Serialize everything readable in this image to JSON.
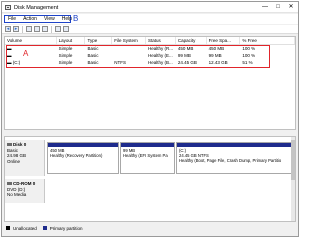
{
  "window": {
    "title": "Disk Management",
    "min": "—",
    "max": "□",
    "close": "✕"
  },
  "menu": {
    "items": [
      "File",
      "Action",
      "View",
      "Help"
    ]
  },
  "annotations": {
    "a": "A",
    "b": "B"
  },
  "volumes": {
    "headers": [
      "Volume",
      "Layout",
      "Type",
      "File System",
      "Status",
      "Capacity",
      "Free Spa...",
      "% Free"
    ],
    "rows": [
      {
        "volume": "",
        "layout": "Simple",
        "type": "Basic",
        "fs": "",
        "status": "Healthy (R...",
        "capacity": "450 MB",
        "free": "450 MB",
        "pct": "100 %"
      },
      {
        "volume": "",
        "layout": "Simple",
        "type": "Basic",
        "fs": "",
        "status": "Healthy (E...",
        "capacity": "99 MB",
        "free": "99 MB",
        "pct": "100 %"
      },
      {
        "volume": "(C:)",
        "layout": "Simple",
        "type": "Basic",
        "fs": "NTFS",
        "status": "Healthy (B...",
        "capacity": "24.45 GB",
        "free": "12.43 GB",
        "pct": "51 %"
      }
    ]
  },
  "disks": [
    {
      "name": "Disk 0",
      "kind": "Basic",
      "size": "24.98 GB",
      "state": "Online",
      "partitions": [
        {
          "title": "",
          "size": "450 MB",
          "status": "Healthy (Recovery Partition)"
        },
        {
          "title": "",
          "size": "99 MB",
          "status": "Healthy (EFI System Pa"
        },
        {
          "title": "(C:)",
          "size": "24.45 GB NTFS",
          "status": "Healthy (Boot, Page File, Crash Dump, Primary Partitio"
        }
      ]
    },
    {
      "name": "CD-ROM 0",
      "kind": "DVD (D:)",
      "size": "",
      "state": "No Media"
    }
  ],
  "legend": [
    {
      "label": "Unallocated",
      "color": "#000000"
    },
    {
      "label": "Primary partition",
      "color": "#1e2b8c"
    }
  ],
  "colors": {
    "annotation_red": "#e0252b",
    "annotation_blue": "#1f44c8",
    "partition_bar": "#1e2b8c"
  }
}
